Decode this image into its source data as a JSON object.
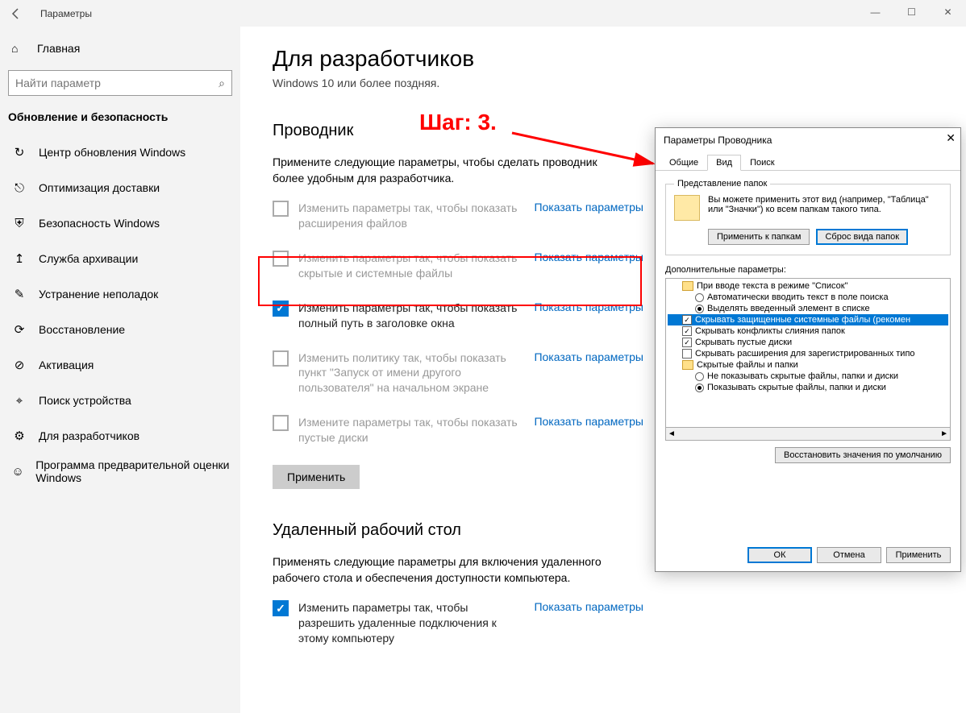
{
  "window": {
    "title": "Параметры",
    "controls": {
      "min": "—",
      "max": "☐",
      "close": "✕"
    }
  },
  "sidebar": {
    "home": "Главная",
    "searchPlaceholder": "Найти параметр",
    "section": "Обновление и безопасность",
    "items": [
      {
        "icon": "↻",
        "label": "Центр обновления Windows"
      },
      {
        "icon": "⎋",
        "label": "Оптимизация доставки"
      },
      {
        "icon": "⛨",
        "label": "Безопасность Windows"
      },
      {
        "icon": "↥",
        "label": "Служба архивации"
      },
      {
        "icon": "✎",
        "label": "Устранение неполадок"
      },
      {
        "icon": "⟳",
        "label": "Восстановление"
      },
      {
        "icon": "⊘",
        "label": "Активация"
      },
      {
        "icon": "⌖",
        "label": "Поиск устройства"
      },
      {
        "icon": "⚙",
        "label": "Для разработчиков"
      },
      {
        "icon": "☺",
        "label": "Программа предварительной оценки Windows"
      }
    ]
  },
  "main": {
    "heading": "Для разработчиков",
    "subtitle": "Windows 10 или более поздняя.",
    "explorer": {
      "title": "Проводник",
      "desc": "Примените следующие параметры, чтобы сделать проводник более удобным для разработчика.",
      "options": [
        {
          "checked": false,
          "text": "Изменить параметры так, чтобы показать расширения файлов",
          "link": "Показать параметры"
        },
        {
          "checked": false,
          "text": "Изменить параметры так, чтобы показать скрытые и системные файлы",
          "link": "Показать параметры"
        },
        {
          "checked": true,
          "text": "Изменить параметры так, чтобы показать полный путь в заголовке окна",
          "link": "Показать параметры"
        },
        {
          "checked": false,
          "text": "Изменить политику так, чтобы показать пункт \"Запуск от имени другого пользователя\" на начальном экране",
          "link": "Показать параметры"
        },
        {
          "checked": false,
          "text": "Измените параметры так, чтобы показать пустые диски",
          "link": "Показать параметры"
        }
      ],
      "apply": "Применить"
    },
    "remote": {
      "title": "Удаленный рабочий стол",
      "desc": "Применять следующие параметры для включения удаленного рабочего стола и обеспечения доступности компьютера.",
      "option": {
        "checked": true,
        "text": "Изменить параметры так, чтобы разрешить удаленные подключения к этому компьютеру",
        "link": "Показать параметры"
      }
    }
  },
  "annotation": "Шаг: 3.",
  "dialog": {
    "title": "Параметры Проводника",
    "tabs": [
      "Общие",
      "Вид",
      "Поиск"
    ],
    "activeTab": 1,
    "folderView": {
      "legend": "Представление папок",
      "desc": "Вы можете применить этот вид (например, \"Таблица\" или \"Значки\") ко всем папкам такого типа.",
      "applyBtn": "Применить к папкам",
      "resetBtn": "Сброс вида папок"
    },
    "advancedLabel": "Дополнительные параметры:",
    "tree": [
      {
        "type": "folder",
        "indent": 1,
        "label": "При вводе текста в режиме \"Список\""
      },
      {
        "type": "radio",
        "indent": 2,
        "on": false,
        "label": "Автоматически вводить текст в поле поиска"
      },
      {
        "type": "radio",
        "indent": 2,
        "on": true,
        "label": "Выделять введенный элемент в списке"
      },
      {
        "type": "check",
        "indent": 1,
        "on": true,
        "sel": true,
        "label": "Скрывать защищенные системные файлы (рекомен"
      },
      {
        "type": "check",
        "indent": 1,
        "on": true,
        "label": "Скрывать конфликты слияния папок"
      },
      {
        "type": "check",
        "indent": 1,
        "on": true,
        "label": "Скрывать пустые диски"
      },
      {
        "type": "check",
        "indent": 1,
        "on": false,
        "label": "Скрывать расширения для зарегистрированных типо"
      },
      {
        "type": "folder",
        "indent": 1,
        "label": "Скрытые файлы и папки"
      },
      {
        "type": "radio",
        "indent": 2,
        "on": false,
        "label": "Не показывать скрытые файлы, папки и диски"
      },
      {
        "type": "radio",
        "indent": 2,
        "on": true,
        "label": "Показывать скрытые файлы, папки и диски"
      }
    ],
    "restoreBtn": "Восстановить значения по умолчанию",
    "okBtn": "ОК",
    "cancelBtn": "Отмена",
    "applyBtn": "Применить"
  }
}
